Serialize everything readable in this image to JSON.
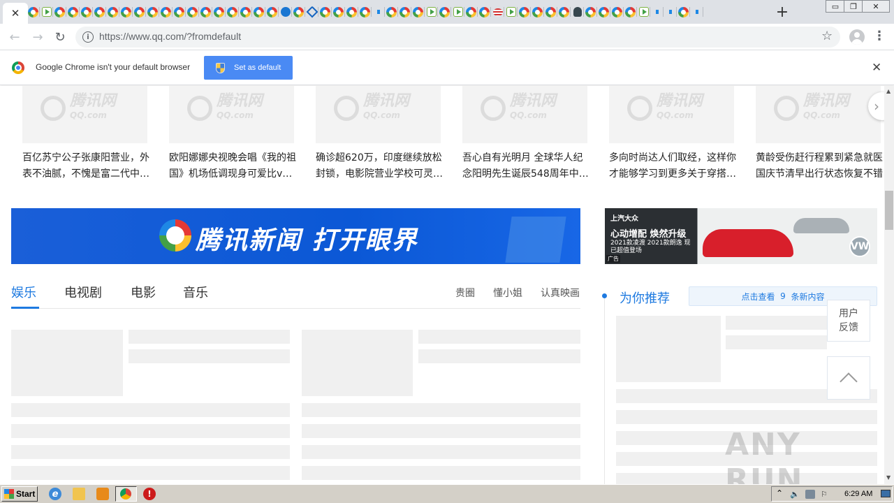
{
  "browser": {
    "active_tab_close": "✕",
    "new_tab": "+",
    "window_buttons": {
      "minimize": "▭",
      "restore": "❐",
      "close": "✕"
    },
    "tab_favicons": [
      "qq",
      "play",
      "qq",
      "qq",
      "qq",
      "qq",
      "qq",
      "qq",
      "qq",
      "qq",
      "qq",
      "qq",
      "qq",
      "qq",
      "qq",
      "qq",
      "qq",
      "qq",
      "qq",
      "blue",
      "qq",
      "home",
      "qq",
      "qq",
      "qq",
      "qq",
      "mini",
      "qq",
      "qq",
      "qq",
      "play",
      "qq",
      "play",
      "qq",
      "qq",
      "flag",
      "play",
      "qq",
      "qq",
      "qq",
      "qq",
      "dark",
      "qq",
      "qq",
      "qq",
      "qq",
      "play",
      "mini",
      "mini",
      "qq",
      "mini"
    ],
    "nav": {
      "back": "←",
      "forward": "→",
      "reload": "↻"
    },
    "url": "https://www.qq.com/?fromdefault",
    "info_icon": "i",
    "star": "☆",
    "menu": "⋮"
  },
  "infobar": {
    "message": "Google Chrome isn't your default browser",
    "button_label": "Set as default",
    "close": "✕"
  },
  "news_thumbs": {
    "watermark": "腾讯网",
    "watermark_sub": "QQ.com",
    "items": [
      {
        "caption": "百亿苏宁公子张康阳营业，外表不油腻，不愧是富二代中…"
      },
      {
        "caption": "欧阳娜娜央视晚会唱《我的祖国》机场低调现身可爱比v…"
      },
      {
        "caption": "确诊超620万，印度继续放松封锁，电影院营业学校可灵…"
      },
      {
        "caption": "吾心自有光明月 全球华人纪念阳明先生诞辰548周年中…"
      },
      {
        "caption": "多向时尚达人们取经，这样你才能够学习到更多关于穿搭…"
      },
      {
        "caption": "黄龄受伤赶行程累到紧急就医国庆节清早出行状态恢复不错"
      }
    ]
  },
  "banner": {
    "text": "腾讯新闻 打开眼界"
  },
  "ad": {
    "brand": "上汽大众",
    "title": "心动增配 焕然升级",
    "sub": "2021款凌渡 2021款朗逸 现已超值登场",
    "tag": "广告",
    "vw": "VW"
  },
  "entertainment": {
    "tabs": [
      "娱乐",
      "电视剧",
      "电影",
      "音乐"
    ],
    "links": [
      "贵圈",
      "懂小姐",
      "认真映画"
    ]
  },
  "recommend": {
    "title": "为你推荐",
    "button_prefix": "点击查看",
    "count": "9",
    "button_suffix": "条新内容"
  },
  "side": {
    "feedback_line1": "用户",
    "feedback_line2": "反馈"
  },
  "watermark": "ANY RUN",
  "taskbar": {
    "start": "Start",
    "ie": "e",
    "stop": "!",
    "clock": "6:29 AM",
    "tray_arrow": "⌃"
  }
}
